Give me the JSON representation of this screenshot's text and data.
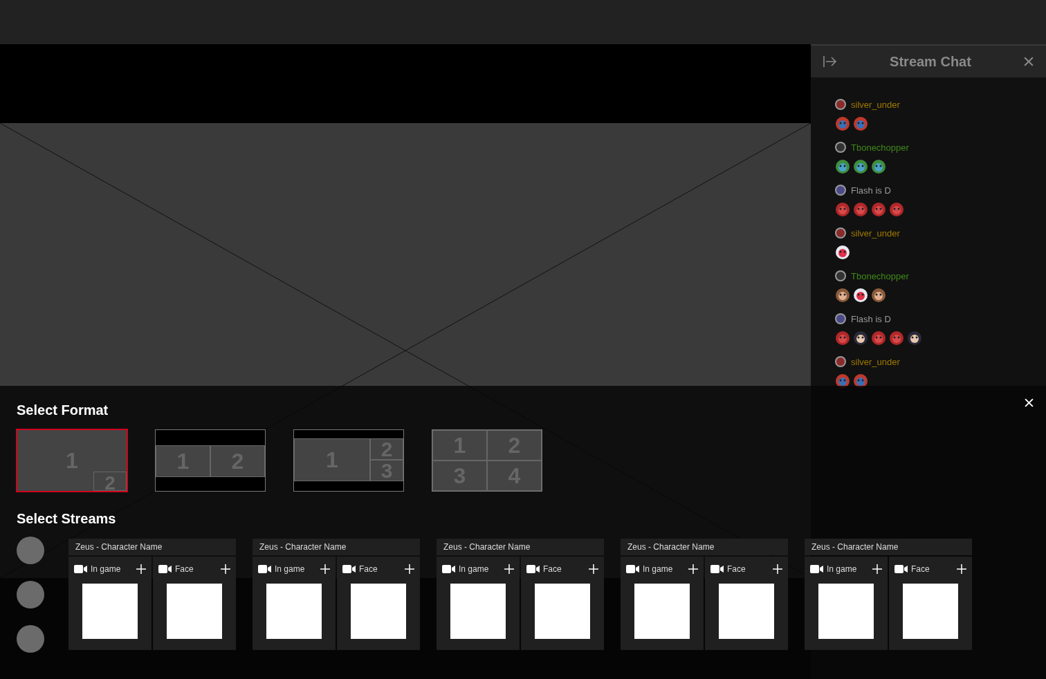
{
  "chat": {
    "title": "Stream Chat",
    "messages": [
      {
        "user": "silver_under",
        "color": "#a07a00",
        "badge": {
          "kind": "crest"
        },
        "emotes": [
          {
            "kind": "jester"
          },
          {
            "kind": "jester"
          }
        ]
      },
      {
        "user": "Tbonechopper",
        "color": "#3f8a1a",
        "badge": {
          "kind": "logo"
        },
        "emotes": [
          {
            "kind": "crying"
          },
          {
            "kind": "crying"
          },
          {
            "kind": "crying"
          }
        ]
      },
      {
        "user": "Flash is D",
        "color": "#9a9a9a",
        "badge": {
          "kind": "tank"
        },
        "emotes": [
          {
            "kind": "gg"
          },
          {
            "kind": "gg"
          },
          {
            "kind": "gg"
          },
          {
            "kind": "gg"
          }
        ]
      },
      {
        "user": "silver_under",
        "color": "#a07a00",
        "badge": {
          "kind": "crest"
        },
        "emotes": [
          {
            "kind": "poro"
          }
        ]
      },
      {
        "user": "Tbonechopper",
        "color": "#3f8a1a",
        "badge": {
          "kind": "logo"
        },
        "emotes": [
          {
            "kind": "girl"
          },
          {
            "kind": "poro"
          },
          {
            "kind": "girl"
          }
        ]
      },
      {
        "user": "Flash is D",
        "color": "#9a9a9a",
        "badge": {
          "kind": "tank"
        },
        "emotes": [
          {
            "kind": "gg"
          },
          {
            "kind": "shout"
          },
          {
            "kind": "gg"
          },
          {
            "kind": "gg"
          },
          {
            "kind": "shout"
          }
        ]
      },
      {
        "user": "silver_under",
        "color": "#a07a00",
        "badge": {
          "kind": "crest"
        },
        "emotes": [
          {
            "kind": "jester"
          },
          {
            "kind": "jester"
          }
        ]
      }
    ]
  },
  "panel": {
    "format_title": "Select Format",
    "formats": [
      {
        "kind": "pip",
        "selected": true,
        "cells": [
          "1",
          "2"
        ]
      },
      {
        "kind": "split",
        "selected": false,
        "cells": [
          "1",
          "2"
        ]
      },
      {
        "kind": "main-side",
        "selected": false,
        "cells": [
          "1",
          "2",
          "3"
        ]
      },
      {
        "kind": "grid",
        "selected": false,
        "cells": [
          "1",
          "2",
          "3",
          "4"
        ]
      }
    ],
    "streams_title": "Select Streams",
    "streams": [
      {
        "title": "Zeus - Character Name",
        "sources": [
          "In game",
          "Face"
        ]
      },
      {
        "title": "Zeus - Character Name",
        "sources": [
          "In game",
          "Face"
        ]
      },
      {
        "title": "Zeus - Character Name",
        "sources": [
          "In game",
          "Face"
        ]
      },
      {
        "title": "Zeus - Character Name",
        "sources": [
          "In game",
          "Face"
        ]
      },
      {
        "title": "Zeus - Character Name",
        "sources": [
          "In game",
          "Face"
        ]
      }
    ]
  }
}
